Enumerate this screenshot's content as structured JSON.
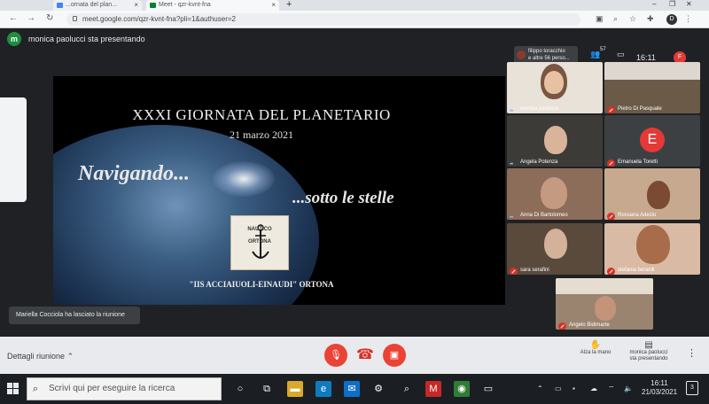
{
  "browser": {
    "tab1_title": "...ornata del plan...",
    "tab2_title": "Meet - qzr-kvnt-fna",
    "url": "meet.google.com/qzr-kvnt-fna?pli=1&authuser=2",
    "profile_initial": "D"
  },
  "meet": {
    "presenter_initial": "m",
    "presenter_text": "monica paolucci sta presentando",
    "chip_text_line1": "filippo toracchio",
    "chip_text_line2": "e altre 56 perso...",
    "people_count": "57",
    "clock": "16:11",
    "user_initial": "F",
    "toast": "Mariella Cocciola ha lasciato la riunione"
  },
  "slide": {
    "title": "XXXI GIORNATA DEL PLANETARIO",
    "date": "21 marzo 2021",
    "script1": "Navigando...",
    "script2": "...sotto le stelle",
    "logo_line1": "NAUTICO",
    "logo_line2": "ORTONA",
    "school": "\"IIS ACCIAIUOLI-EINAUDI\" ORTONA"
  },
  "participants": [
    {
      "name": "monica paolucci",
      "avatar": ""
    },
    {
      "name": "Pietro Di Pasquale",
      "avatar": ""
    },
    {
      "name": "Angela Potenza",
      "avatar": ""
    },
    {
      "name": "Emanuela Toretti",
      "avatar": "E"
    },
    {
      "name": "Anna Di Bartolomeo",
      "avatar": ""
    },
    {
      "name": "Rossana Adezio",
      "avatar": ""
    },
    {
      "name": "sara serafini",
      "avatar": ""
    },
    {
      "name": "stefania berardi",
      "avatar": ""
    },
    {
      "name": "Angelo Bidimarte",
      "avatar": ""
    }
  ],
  "toolbar": {
    "details": "Dettagli riunione",
    "raise_hand": "Alza la mano",
    "presenting_line1": "monica paolucci",
    "presenting_line2": "sta presentando"
  },
  "taskbar": {
    "search_placeholder": "Scrivi qui per eseguire la ricerca",
    "time": "16:11",
    "date": "21/03/2021",
    "notifications": "3"
  }
}
